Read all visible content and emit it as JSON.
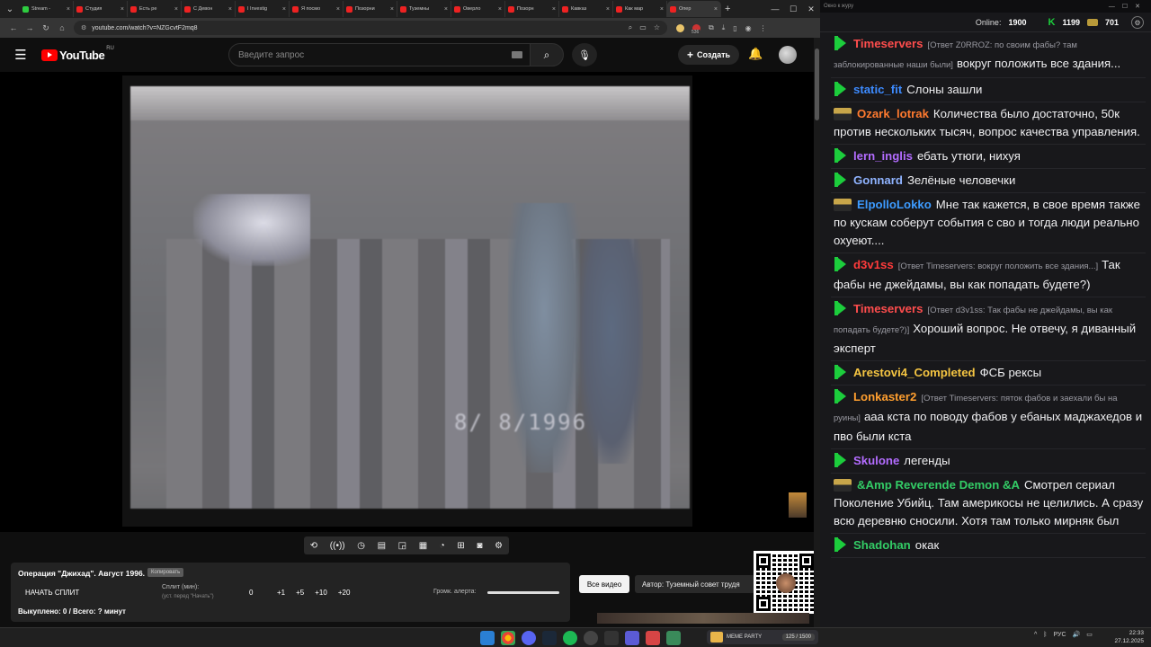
{
  "browser": {
    "tabs": [
      {
        "label": "Stream -",
        "color": "#2ecc40"
      },
      {
        "label": "Студия",
        "color": "#e22"
      },
      {
        "label": "Есть ре",
        "color": "#e22"
      },
      {
        "label": "С Девон",
        "color": "#e22"
      },
      {
        "label": "I Investig",
        "color": "#e22"
      },
      {
        "label": "Я посмо",
        "color": "#e22"
      },
      {
        "label": "Позорни",
        "color": "#e22"
      },
      {
        "label": "Туземны",
        "color": "#e22"
      },
      {
        "label": "Оверло",
        "color": "#e22"
      },
      {
        "label": "Позорн",
        "color": "#e22"
      },
      {
        "label": "Кавказ",
        "color": "#e22"
      },
      {
        "label": "Как мар",
        "color": "#e22"
      },
      {
        "label": "Опер",
        "color": "#e22",
        "active": true
      }
    ],
    "url": "youtube.com/watch?v=NZGcvtF2mq8",
    "ext_badge": "536"
  },
  "youtube": {
    "logo_text": "YouTube",
    "region": "RU",
    "search_placeholder": "Введите запрос",
    "create_label": "Создать"
  },
  "video": {
    "timestamp_text": "8/ 8/1996"
  },
  "panel": {
    "title": "Операция \"Джихад\". Август 1996.",
    "copy_label": "Копировать",
    "start_split": "НАЧАТЬ СПЛИТ",
    "split_label": "Сплит (мин):",
    "split_hint": "(уст. перед \"Начать\")",
    "split_value": "0",
    "step_buttons": [
      "+1",
      "+5",
      "+10",
      "+20"
    ],
    "alert_label": "Громк. алерта:",
    "bought_text": "Выкуплено: 0 / Всего: ? минут",
    "all_videos": "Все видео",
    "author": "Автор: Туземный совет трудя"
  },
  "chat": {
    "window_title": "Окно к журу",
    "online_label": "Online:",
    "online_count": "1900",
    "kick_count": "1199",
    "other_count": "701",
    "messages": [
      {
        "badge": "k",
        "nick": "Timeservers",
        "color": "#ff4d4d",
        "reply": "[Ответ Z0RROZ: по своим фабы? там заблокированные наши были]",
        "text": "вокруг положить все здания..."
      },
      {
        "badge": "k",
        "nick": "static_fit",
        "color": "#3d8bff",
        "reply": "",
        "text": "Слоны зашли"
      },
      {
        "badge": "p",
        "nick": "Ozark_lotrak",
        "color": "#ff7a2f",
        "reply": "",
        "text": "Количества было достаточно, 50к против нескольких тысяч, вопрос качества управления."
      },
      {
        "badge": "k",
        "nick": "lern_inglis",
        "color": "#b36cff",
        "reply": "",
        "text": "ебать утюги, нихуя"
      },
      {
        "badge": "k",
        "nick": "Gonnard",
        "color": "#8fb3ff",
        "reply": "",
        "text": "Зелёные человечки"
      },
      {
        "badge": "p",
        "nick": "ElpolloLokko",
        "color": "#3d9bff",
        "reply": "",
        "text": "Мне так кажется, в свое время также по кускам соберут события с сво и тогда люди реально охуеют...."
      },
      {
        "badge": "k",
        "nick": "d3v1ss",
        "color": "#ff3b3b",
        "reply": "[Ответ Timeservers: вокруг положить все здания...]",
        "text": "Так фабы не джейдамы, вы как попадать будете?)"
      },
      {
        "badge": "k",
        "nick": "Timeservers",
        "color": "#ff4d4d",
        "reply": "[Ответ d3v1ss: Так фабы не джейдамы, вы как попадать будете?)]",
        "text": "Хороший вопрос. Не отвечу, я диванный эксперт"
      },
      {
        "badge": "k",
        "nick": "Arestovi4_Completed",
        "color": "#f5c542",
        "reply": "",
        "text": "ФСБ рексы"
      },
      {
        "badge": "k",
        "nick": "Lonkaster2",
        "color": "#ff9f2f",
        "reply": "[Ответ Timeservers: пяток фабов и заехали бы на руины]",
        "text": "ааа кста по поводу фабов у ебаных маджахедов и пво были кста"
      },
      {
        "badge": "k",
        "nick": "Skulone",
        "color": "#b36cff",
        "reply": "",
        "text": "легенды"
      },
      {
        "badge": "p",
        "nick": "&Amp Reverende Demon &A",
        "color": "#33cc66",
        "reply": "",
        "text": "Смотрел сериал Поколение Убийц. Там америкосы не целились. А сразу всю деревню сносили. Хотя там только мирняк был"
      },
      {
        "badge": "k",
        "nick": "Shadohan",
        "color": "#33cc66",
        "reply": "",
        "text": "окак"
      }
    ]
  },
  "taskbar": {
    "music_label": "MEME PARTY",
    "music_progress": "125 / 1500",
    "lang": "РУС",
    "time": "22:33",
    "date": "27.12.2025"
  }
}
